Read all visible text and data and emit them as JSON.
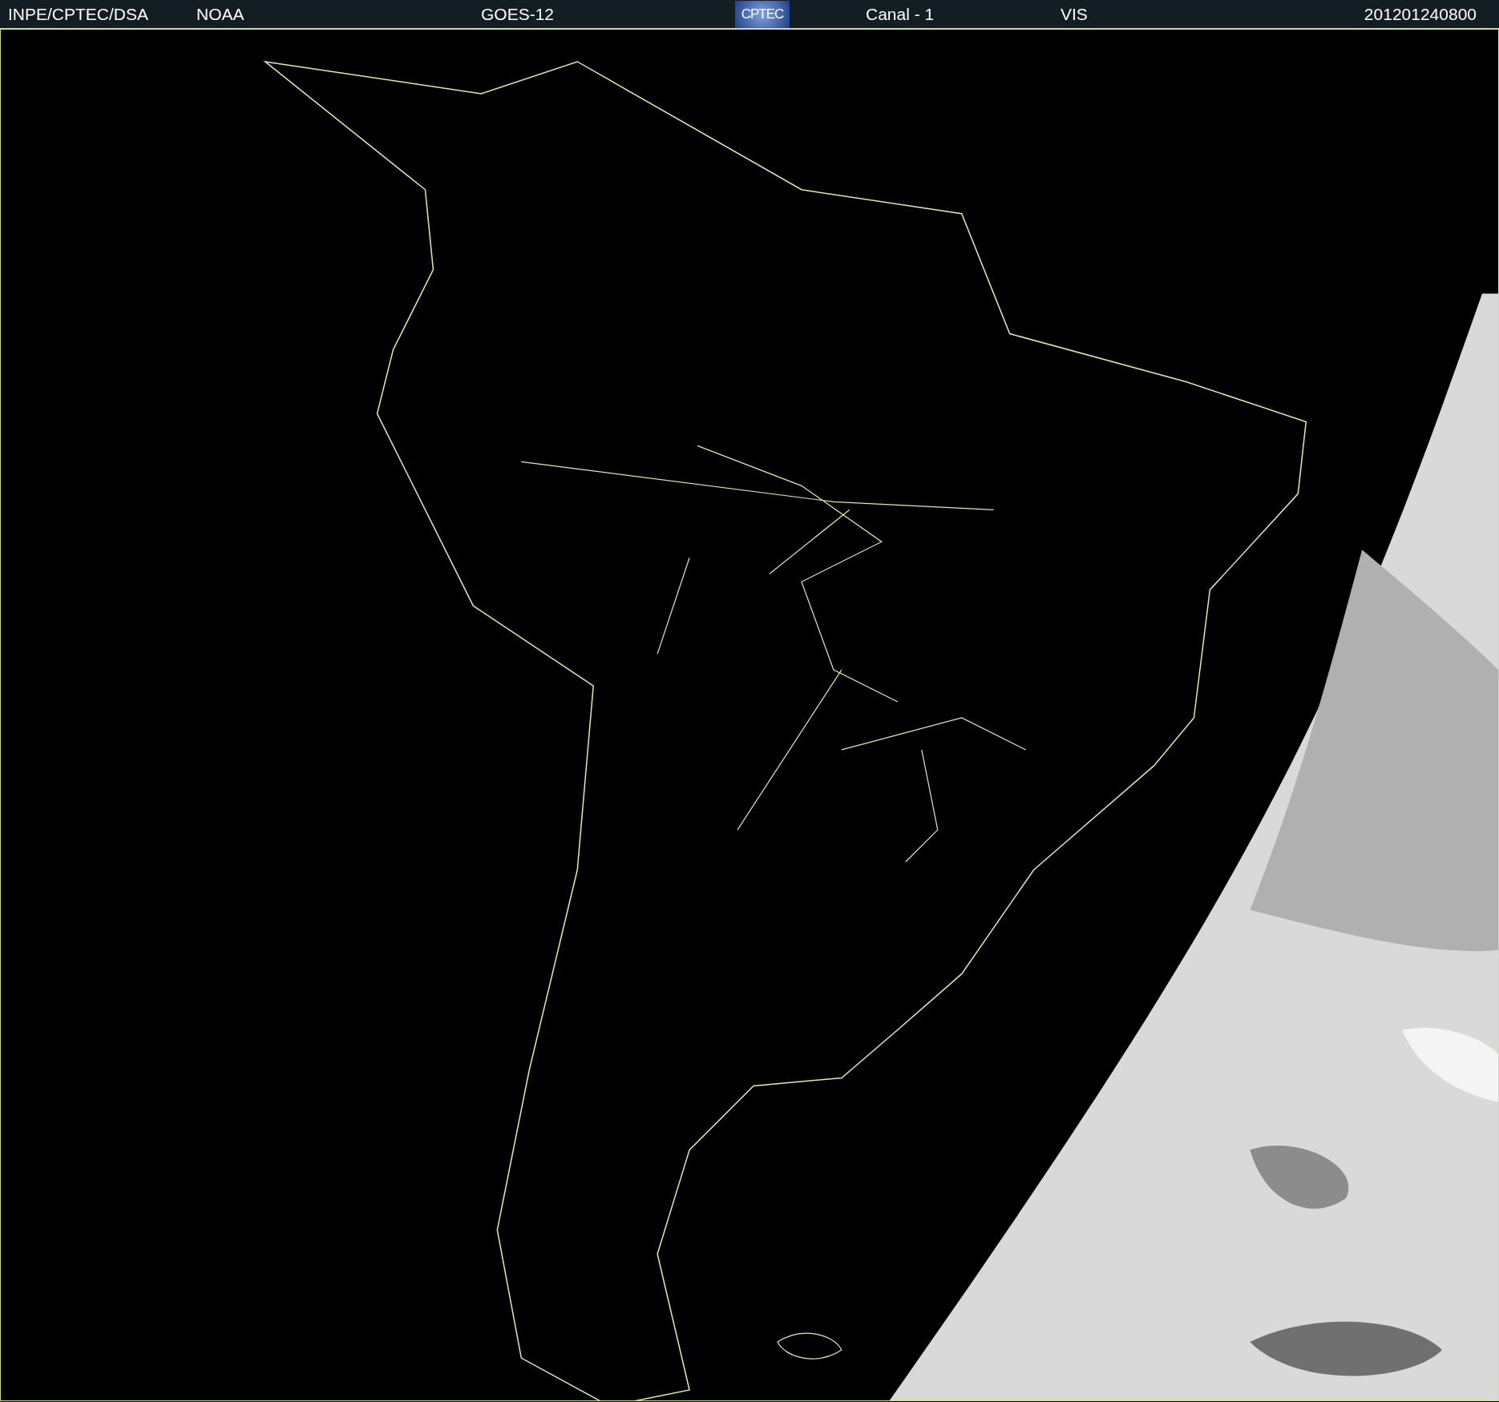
{
  "header": {
    "items": [
      {
        "kind": "text",
        "text": "INPE/CPTEC/DSA"
      },
      {
        "kind": "text",
        "text": "NOAA"
      },
      {
        "kind": "text",
        "text": "GOES-12"
      },
      {
        "kind": "logo",
        "text": "CPTEC"
      },
      {
        "kind": "text",
        "text": "Canal - 1"
      },
      {
        "kind": "text",
        "text": "VIS"
      },
      {
        "kind": "text",
        "text": "201201240800"
      }
    ]
  }
}
